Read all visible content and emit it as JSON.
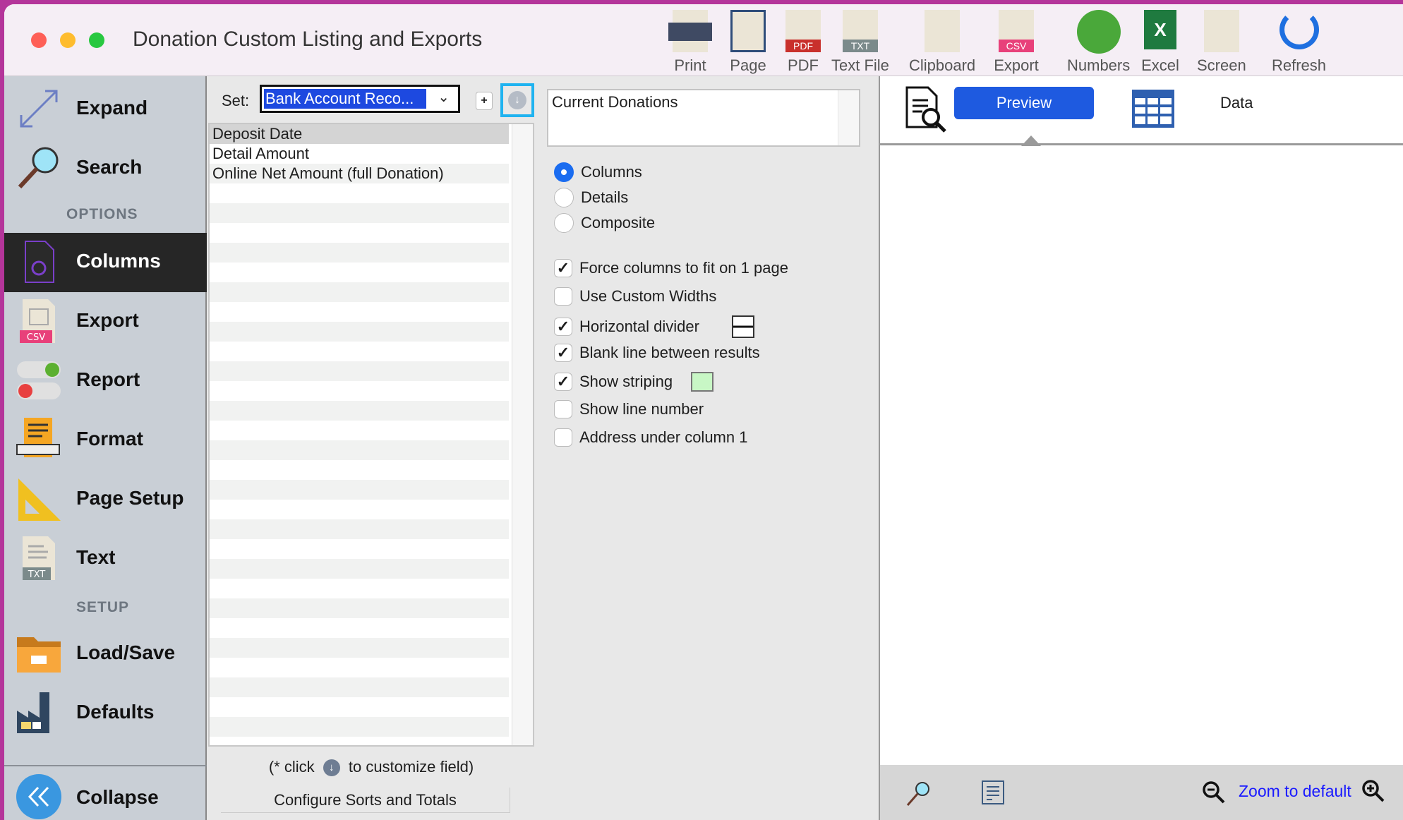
{
  "window": {
    "title": "Donation Custom Listing and Exports"
  },
  "toolbar": [
    {
      "label": "Print",
      "icon": "printer-icon"
    },
    {
      "label": "Page",
      "icon": "page-icon"
    },
    {
      "label": "PDF",
      "icon": "pdf-icon",
      "badge": "PDF"
    },
    {
      "label": "Text File",
      "icon": "txt-file-icon",
      "badge": "TXT"
    },
    {
      "label": "Clipboard",
      "icon": "clipboard-icon"
    },
    {
      "label": "Export",
      "icon": "csv-icon",
      "badge": "CSV"
    },
    {
      "label": "Numbers",
      "icon": "numbers-icon"
    },
    {
      "label": "Excel",
      "icon": "excel-icon"
    },
    {
      "label": "Screen",
      "icon": "screen-icon"
    },
    {
      "label": "Refresh",
      "icon": "refresh-icon"
    }
  ],
  "sidebar": {
    "expand": "Expand",
    "search": "Search",
    "options_header": "OPTIONS",
    "items": [
      {
        "label": "Columns"
      },
      {
        "label": "Export",
        "badge": "CSV"
      },
      {
        "label": "Report"
      },
      {
        "label": "Format"
      },
      {
        "label": "Page Setup"
      },
      {
        "label": "Text",
        "badge": "TXT"
      }
    ],
    "setup_header": "SETUP",
    "setup_items": [
      {
        "label": "Load/Save"
      },
      {
        "label": "Defaults"
      }
    ],
    "collapse": "Collapse"
  },
  "set": {
    "label": "Set:",
    "value": "Bank Account Reco..."
  },
  "columns": [
    "Deposit Date",
    "Detail Amount",
    "Online Net Amount (full Donation)"
  ],
  "hint": {
    "before": "(* click",
    "after": "to customize field)"
  },
  "configure_button": "Configure Sorts and Totals",
  "source_box": "Current Donations",
  "layout_options": [
    {
      "label": "Columns",
      "selected": true
    },
    {
      "label": "Details",
      "selected": false
    },
    {
      "label": "Composite",
      "selected": false
    }
  ],
  "checkboxes": [
    {
      "label": "Force columns to fit on 1 page",
      "checked": true
    },
    {
      "label": "Use Custom Widths",
      "checked": false
    },
    {
      "label": "Horizontal divider",
      "checked": true
    },
    {
      "label": "Blank line between results",
      "checked": true
    },
    {
      "label": "Show striping",
      "checked": true,
      "swatch": "#c8f7c5"
    },
    {
      "label": "Show line number",
      "checked": false
    },
    {
      "label": "Address under column 1",
      "checked": false
    }
  ],
  "preview": {
    "preview_tab": "Preview",
    "data_tab": "Data",
    "zoom_label": "Zoom to default"
  }
}
